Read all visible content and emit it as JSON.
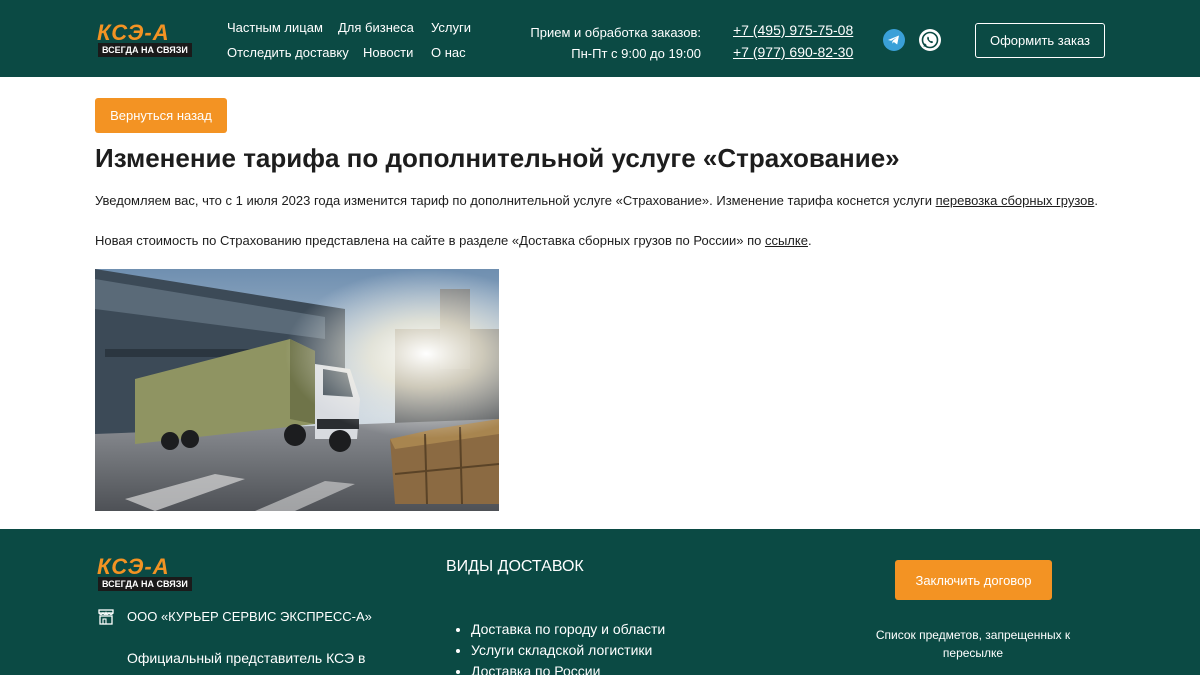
{
  "header": {
    "logo_text": "КСЭ-А",
    "logo_tagline": "ВСЕГДА НА СВЯЗИ",
    "nav": {
      "private": "Частным лицам",
      "business": "Для бизнеса",
      "services": "Услуги",
      "tracking": "Отследить доставку",
      "news": "Новости",
      "about": "О нас"
    },
    "hours_line1": "Прием и обработка заказов:",
    "hours_line2": "Пн-Пт с 9:00 до 19:00",
    "phone1": "+7 (495) 975-75-08",
    "phone2": "+7 (977) 690-82-30",
    "telegram_icon": "telegram-icon",
    "whatsapp_icon": "whatsapp-icon",
    "order_button": "Оформить заказ"
  },
  "main": {
    "back_button": "Вернуться назад",
    "title": "Изменение тарифа по дополнительной услуге «Страхование»",
    "para1_text": "Уведомляем вас, что с 1 июля 2023 года изменится тариф по дополнительной услуге «Страхование». Изменение тарифа коснется услуги ",
    "para1_link": "перевозка сборных грузов",
    "para1_end": ".",
    "para2_text": "Новая стоимость по Страхованию представлена на сайте в разделе «Доставка сборных грузов по России» по ",
    "para2_link": "ссылке",
    "para2_end": "."
  },
  "footer": {
    "logo_text": "КСЭ-А",
    "logo_tagline": "ВСЕГДА НА СВЯЗИ",
    "company_name": "ООО «КУРЬЕР СЕРВИС ЭКСПРЕСС-А»",
    "representative": "Официальный представитель КСЭ в",
    "delivery_title": "ВИДЫ ДОСТАВОК",
    "delivery_items": [
      "Доставка по городу и области",
      "Услуги складской логистики",
      "Доставка по России"
    ],
    "contract_button": "Заключить договор",
    "prohibited_link": "Список предметов, запрещенных к пересылке"
  },
  "colors": {
    "brand_dark": "#0b4a44",
    "accent_orange": "#f39323"
  }
}
